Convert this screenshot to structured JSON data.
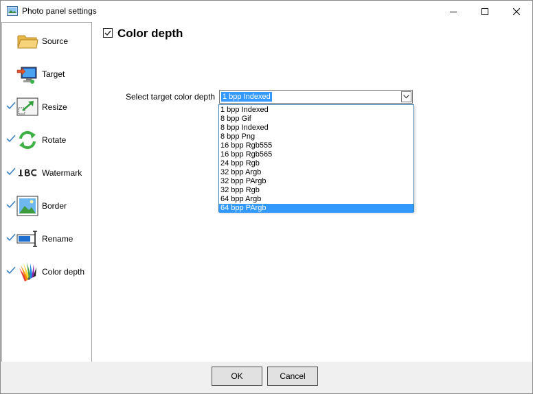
{
  "window": {
    "title": "Photo panel settings",
    "icon": "photo-panel-icon",
    "controls": [
      "minimize-icon",
      "maximize-icon",
      "close-icon"
    ]
  },
  "sidebar": {
    "items": [
      {
        "label": "Source",
        "icon": "folder-icon",
        "checked": false
      },
      {
        "label": "Target",
        "icon": "computer-target-icon",
        "checked": false
      },
      {
        "label": "Resize",
        "icon": "resize-icon",
        "checked": true
      },
      {
        "label": "Rotate",
        "icon": "rotate-icon",
        "checked": true
      },
      {
        "label": "Watermark",
        "icon": "watermark-abc-icon",
        "checked": true
      },
      {
        "label": "Border",
        "icon": "border-picture-icon",
        "checked": true
      },
      {
        "label": "Rename",
        "icon": "rename-icon",
        "checked": true
      },
      {
        "label": "Color depth",
        "icon": "color-palette-icon",
        "checked": true
      }
    ]
  },
  "main": {
    "section_title": "Color depth",
    "section_enabled": true,
    "field_label": "Select target color depth",
    "selected_value": "1 bpp Indexed",
    "options": [
      "1 bpp Indexed",
      "8 bpp Gif",
      "8 bpp Indexed",
      "8 bpp Png",
      "16 bpp Rgb555",
      "16 bpp Rgb565",
      "24 bpp Rgb",
      "32 bpp Argb",
      "32 bpp PArgb",
      "32 bpp Rgb",
      "64 bpp Argb",
      "64 bpp PArgb"
    ],
    "highlighted_option": "64 bpp PArgb"
  },
  "footer": {
    "ok_label": "OK",
    "cancel_label": "Cancel"
  },
  "colors": {
    "selection": "#3399ff",
    "checkmark": "#3b7fc4",
    "footer_bg": "#f0f0f0"
  }
}
